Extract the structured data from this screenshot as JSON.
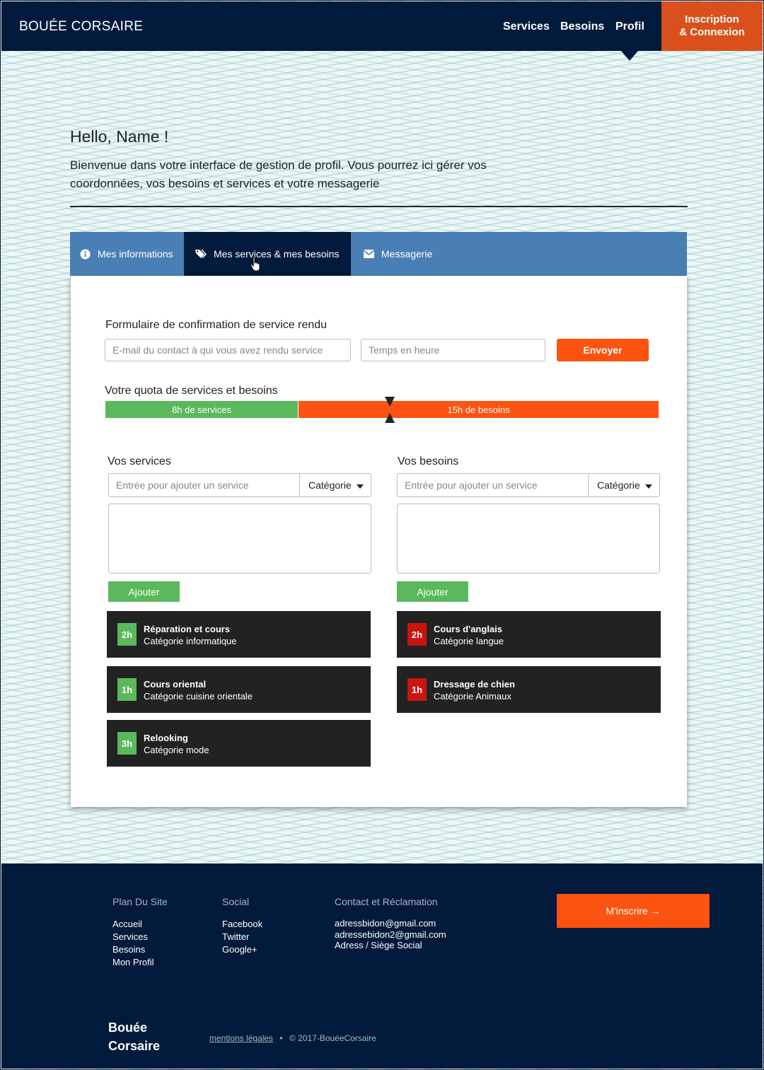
{
  "header": {
    "brand": "BOUÉE CORSAIRE",
    "nav": [
      "Services",
      "Besoins",
      "Profil"
    ],
    "signin_line1": "Inscription",
    "signin_line2": "& Connexion"
  },
  "intro": {
    "greeting": "Hello, Name !",
    "text": "Bienvenue dans votre interface de gestion de profil. Vous pourrez ici gérer vos coordonnées, vos besoins et services et votre messagerie"
  },
  "tabs": [
    {
      "label": "Mes informations",
      "icon": "info-icon"
    },
    {
      "label": "Mes services & mes besoins",
      "icon": "tags-icon"
    },
    {
      "label": "Messagerie",
      "icon": "envelope-icon"
    }
  ],
  "confirm_form": {
    "title": "Formulaire de confirmation de service rendu",
    "email_placeholder": "E-mail du contact à qui vous avez rendu service",
    "time_placeholder": "Temps en heure",
    "submit": "Envoyer"
  },
  "quota": {
    "title": "Votre quota de services et besoins",
    "services_label": "8h de services",
    "needs_label": "15h de besoins",
    "services_hours": 8,
    "needs_hours": 15
  },
  "services": {
    "title": "Vos services",
    "input_placeholder": "Entrée pour ajouter un service",
    "category_select": "Catégorie",
    "add_button": "Ajouter",
    "items": [
      {
        "hours": "2h",
        "name": "Réparation et cours",
        "category": "Catégorie informatique"
      },
      {
        "hours": "1h",
        "name": "Cours oriental",
        "category": "Catégorie cuisine orientale"
      },
      {
        "hours": "3h",
        "name": "Relooking",
        "category": "Catégorie mode"
      }
    ]
  },
  "needs": {
    "title": "Vos besoins",
    "input_placeholder": "Entrée pour ajouter un service",
    "category_select": "Catégorie",
    "add_button": "Ajouter",
    "items": [
      {
        "hours": "2h",
        "name": "Cours d'anglais",
        "category": "Catégorie langue"
      },
      {
        "hours": "1h",
        "name": "Dressage de chien",
        "category": "Catégorie Animaux"
      }
    ]
  },
  "footer": {
    "sitemap_title": "Plan Du Site",
    "sitemap": [
      "Accueil",
      "Services",
      "Besoins",
      "Mon Profil"
    ],
    "social_title": "Social",
    "social": [
      "Facebook",
      "Twitter",
      "Google+"
    ],
    "contact_title": "Contact et Réclamation",
    "contact": [
      "adressbidon@gmail.com",
      "adressebidon2@gmail.com",
      "Adress / Siège Social"
    ],
    "subscribe": "M'inscrire →",
    "brand_line1": "Bouée",
    "brand_line2": "Corsaire",
    "legal_link": "mentions légales",
    "legal_sep": "•",
    "copyright": "© 2017-BouéeCorsaire"
  },
  "colors": {
    "navy": "#021a3b",
    "orange": "#fc5310",
    "green": "#5cb85c",
    "tab_blue": "#4a7fb5",
    "need_red": "#c9140f"
  }
}
